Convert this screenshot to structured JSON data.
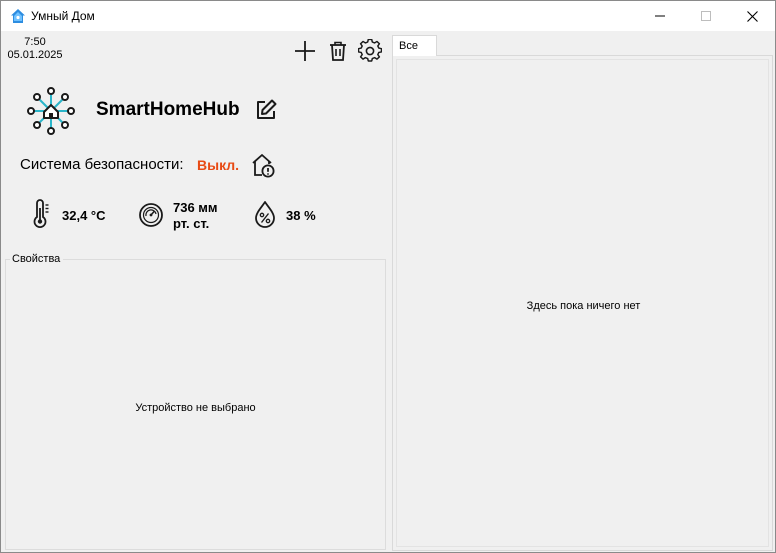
{
  "window": {
    "title": "Умный Дом"
  },
  "clock": {
    "time": "7:50",
    "date": "05.01.2025"
  },
  "toolbar": {
    "add_icon": "plus-icon",
    "delete_icon": "trash-icon",
    "settings_icon": "gear-icon"
  },
  "hub": {
    "name": "SmartHomeHub",
    "logo_icon": "smart-home-hub-icon",
    "edit_icon": "edit-icon"
  },
  "security": {
    "label": "Система безопасности:",
    "status": "Выкл.",
    "status_color": "#e84a14",
    "icon": "home-alert-icon"
  },
  "sensors": {
    "temperature": "32,4 °C",
    "pressure_line1": "736 мм",
    "pressure_line2": "рт. ст.",
    "humidity": "38 %"
  },
  "properties": {
    "title": "Свойства",
    "empty_text": "Устройство не выбрано"
  },
  "tabs": {
    "items": [
      "Все"
    ],
    "empty_text": "Здесь пока ничего нет"
  },
  "colors": {
    "accent": "#2bb5c9",
    "window_bg": "#f0f0f0"
  }
}
